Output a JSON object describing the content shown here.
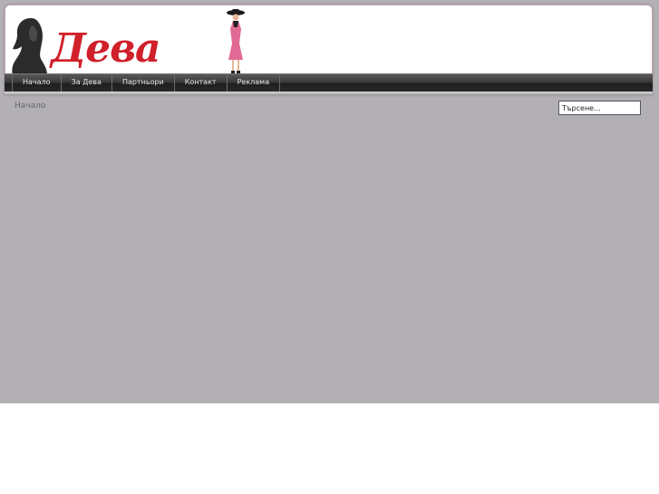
{
  "header": {
    "logo_text": "Дева"
  },
  "nav": {
    "items": [
      {
        "label": "Начало"
      },
      {
        "label": "За Дева"
      },
      {
        "label": "Партньори"
      },
      {
        "label": "Контакт"
      },
      {
        "label": "Реклама"
      }
    ]
  },
  "breadcrumb": {
    "current": "Начало"
  },
  "search": {
    "placeholder": "Търсене..."
  },
  "colors": {
    "page_background": "#b2afb5",
    "brand_red": "#d0202a",
    "nav_dark": "#2a2a2a"
  }
}
